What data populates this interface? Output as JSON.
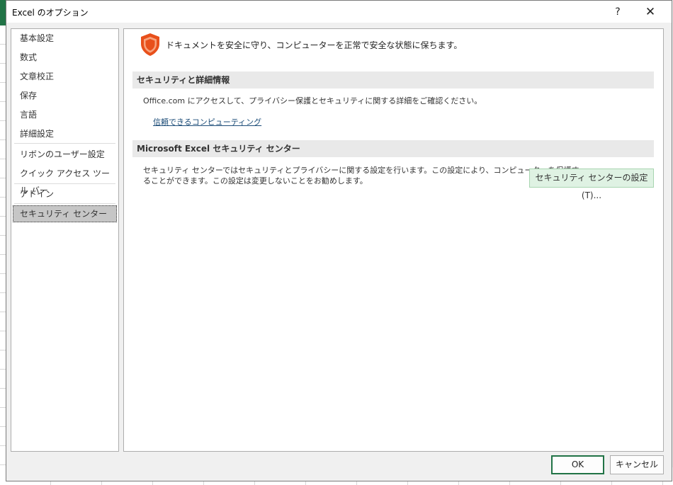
{
  "window": {
    "title": "Excel のオプション",
    "help_icon": "?",
    "close_icon": "✕"
  },
  "sidebar": {
    "items": [
      {
        "label": "基本設定"
      },
      {
        "label": "数式"
      },
      {
        "label": "文章校正"
      },
      {
        "label": "保存"
      },
      {
        "label": "言語"
      },
      {
        "label": "詳細設定"
      },
      {
        "label": "リボンのユーザー設定"
      },
      {
        "label": "クイック アクセス ツール バー"
      },
      {
        "label": "アドイン"
      },
      {
        "label": "セキュリティ センター",
        "selected": true
      }
    ]
  },
  "main": {
    "banner_text": "ドキュメントを安全に守り、コンピューターを正常で安全な状態に保ちます。",
    "banner_icon": "shield-icon",
    "section1": {
      "heading": "セキュリティと詳細情報",
      "text": "Office.com にアクセスして、プライバシー保護とセキュリティに関する詳細をご確認ください。",
      "link": "信頼できるコンピューティング"
    },
    "section2": {
      "heading": "Microsoft Excel セキュリティ センター",
      "text_line1": "セキュリティ センターではセキュリティとプライバシーに関する設定を行います。この設定により、コンピューターを保護す",
      "text_line2": "ることができます。この設定は変更しないことをお勧めします。",
      "button": "セキュリティ センターの設定(T)..."
    }
  },
  "footer": {
    "ok": "OK",
    "cancel": "キャンセル"
  },
  "colors": {
    "accent": "#217346",
    "shield": "#e8501b",
    "selected_bg": "#c6c6c6",
    "section_bg": "#e9e9e9",
    "tc_button_bg": "#dff2e3"
  }
}
